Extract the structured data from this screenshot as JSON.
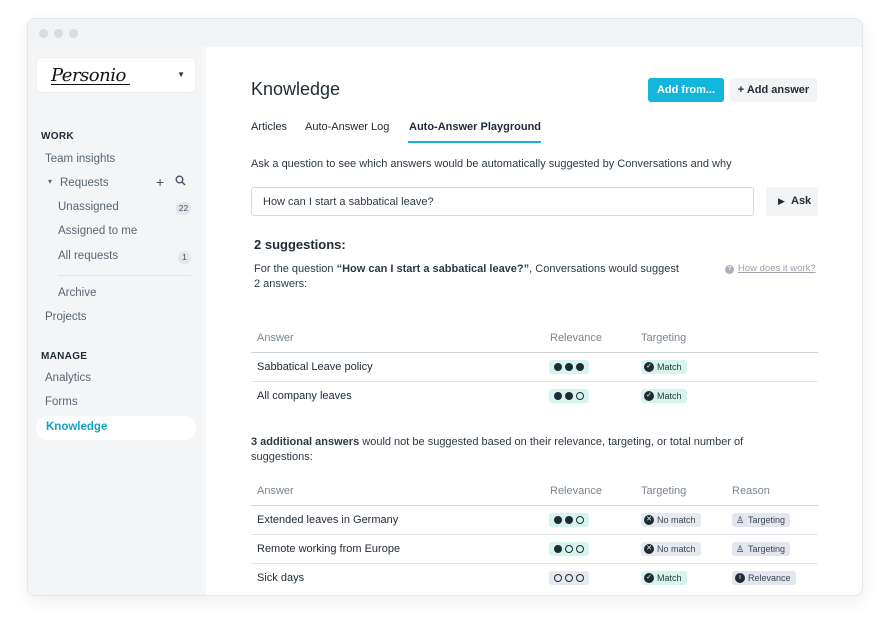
{
  "sidebar": {
    "brand": "Personio",
    "work_label": "WORK",
    "team_insights": "Team insights",
    "requests": "Requests",
    "unassigned": "Unassigned",
    "unassigned_count": "22",
    "assigned_to_me": "Assigned to me",
    "all_requests": "All requests",
    "all_requests_count": "1",
    "archive": "Archive",
    "projects": "Projects",
    "manage_label": "MANAGE",
    "analytics": "Analytics",
    "forms": "Forms",
    "knowledge": "Knowledge"
  },
  "header": {
    "title": "Knowledge",
    "add_from": "Add from...",
    "add_answer": "+ Add answer"
  },
  "tabs": [
    "Articles",
    "Auto-Answer Log",
    "Auto-Answer Playground"
  ],
  "active_tab": "Auto-Answer Playground",
  "playground": {
    "help": "Ask a question to see which answers would be automatically suggested by Conversations and why",
    "question_value": "How can I start a sabbatical leave?",
    "ask_label": "Ask",
    "suggestions_heading": "2 suggestions:",
    "for_question_prefix": "For the question ",
    "for_question_quote": "“How can I start a sabbatical leave?”",
    "for_question_suffix": ", Conversations would suggest",
    "for_question_line2": "2 answers:",
    "how_link": "How does it work?",
    "additional_bold": "3 additional answers",
    "additional_rest": " would not be suggested based on their relevance, targeting, or total number of",
    "additional_line2": "suggestions:"
  },
  "table_headers": {
    "answer": "Answer",
    "relevance": "Relevance",
    "targeting": "Targeting",
    "reason": "Reason"
  },
  "suggested": [
    {
      "answer": "Sabbatical Leave policy",
      "relevance": 3,
      "targeting": "Match"
    },
    {
      "answer": "All company leaves",
      "relevance": 2,
      "targeting": "Match"
    }
  ],
  "not_suggested": [
    {
      "answer": "Extended leaves in Germany",
      "relevance": 2,
      "targeting": "No match",
      "reason": "Targeting"
    },
    {
      "answer": "Remote working from Europe",
      "relevance": 1,
      "targeting": "No match",
      "reason": "Targeting"
    },
    {
      "answer": "Sick days",
      "relevance": 0,
      "targeting": "Match",
      "reason": "Relevance"
    }
  ],
  "colors": {
    "accent": "#12b5dc",
    "match_bg": "#d6f4ee",
    "neutral_bg": "#e6e9ed"
  },
  "icons": {
    "search": "search-icon",
    "plus": "plus-icon",
    "play": "play-icon",
    "check": "check-icon",
    "x": "x-icon",
    "targeting": "person-icon",
    "relevance": "info-icon",
    "help": "question-icon"
  }
}
